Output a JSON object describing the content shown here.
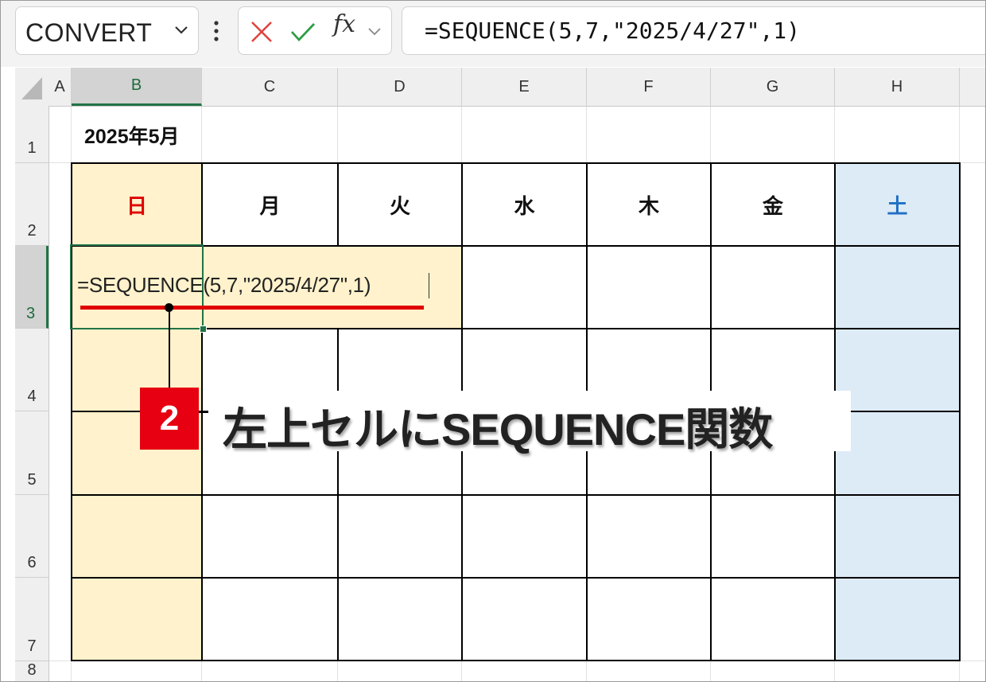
{
  "formula_bar": {
    "name_box": "CONVERT",
    "name_box_icon": "chevron-down-icon",
    "menu_icon": "vertical-dots-icon",
    "cancel_icon": "cross-icon",
    "enter_icon": "check-icon",
    "fx_label": "fx",
    "fx_dropdown_icon": "chevron-down-icon",
    "formula": "=SEQUENCE(5,7,\"2025/4/27\",1)"
  },
  "sheet": {
    "columns": [
      "A",
      "B",
      "C",
      "D",
      "E",
      "F",
      "G",
      "H"
    ],
    "rows": [
      "1",
      "2",
      "3",
      "4",
      "5",
      "6",
      "7",
      "8"
    ],
    "selected_column": "B",
    "selected_row": "3",
    "title": "2025年5月",
    "weekdays": [
      {
        "label": "日",
        "color": "#e00000"
      },
      {
        "label": "月",
        "color": "#111111"
      },
      {
        "label": "火",
        "color": "#111111"
      },
      {
        "label": "水",
        "color": "#111111"
      },
      {
        "label": "木",
        "color": "#111111"
      },
      {
        "label": "金",
        "color": "#111111"
      },
      {
        "label": "土",
        "color": "#1f6fc5"
      }
    ],
    "edit_cell_text": "=SEQUENCE(5,7,\"2025/4/27\",1)",
    "sunday_fill": "#fff2cc",
    "saturday_fill": "#ddebf7",
    "selection_color": "#217346"
  },
  "annotation": {
    "step_number": "2",
    "text": "左上セルにSEQUENCE関数",
    "badge_color": "#e60012",
    "underline_color": "#e00000"
  }
}
